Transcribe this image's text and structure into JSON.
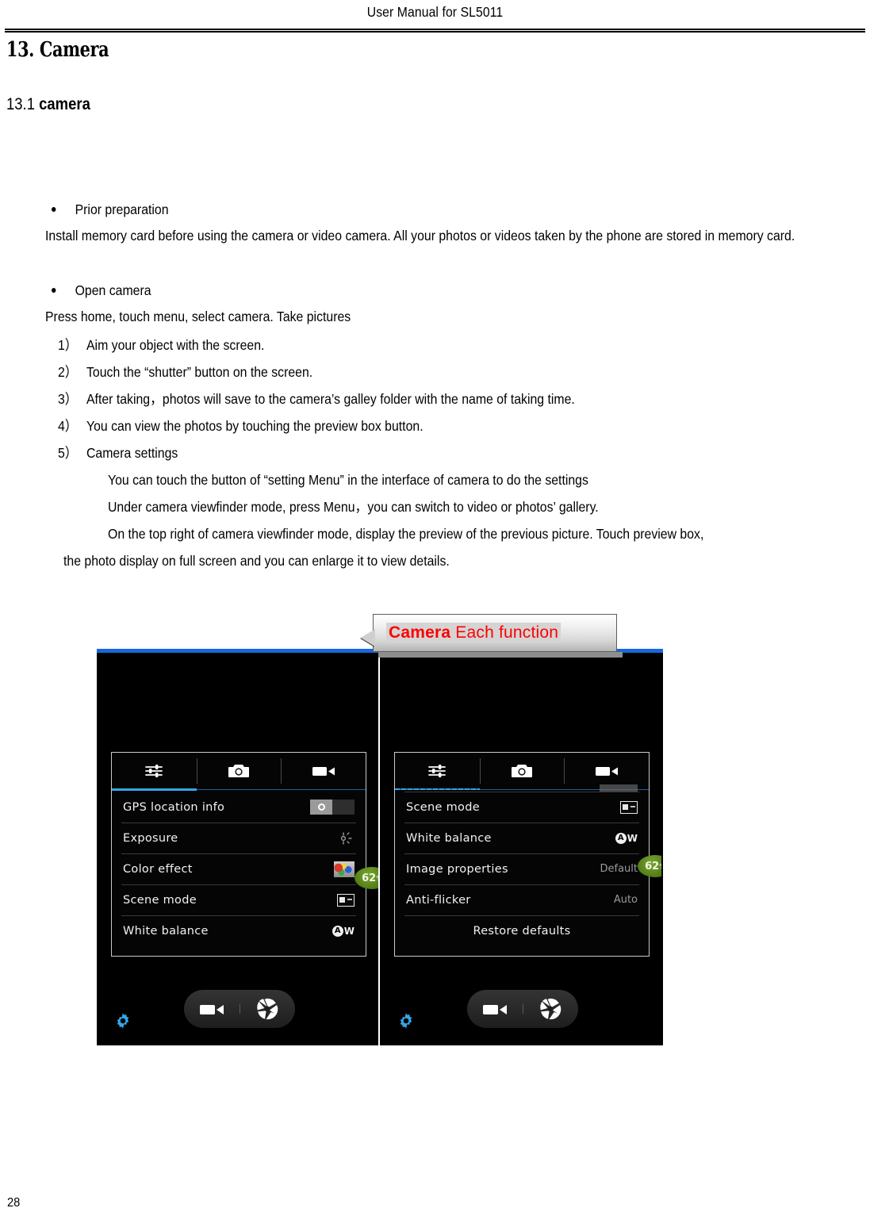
{
  "document": {
    "header_title": "User Manual for SL5011",
    "page_number": "28"
  },
  "headings": {
    "section_number": "13.",
    "section_title": "Camera",
    "sub_number": "13.1",
    "sub_title": "camera"
  },
  "bullets": [
    {
      "text": "Prior preparation"
    },
    {
      "text": "Open camera"
    }
  ],
  "paragraphs": {
    "prior_preparation_body": "Install memory card before using the camera or video camera. All your photos or videos taken by the phone are stored in memory card.",
    "open_camera_body": "Press home, touch menu, select camera. Take pictures"
  },
  "steps": [
    {
      "num": "1）",
      "text": "Aim your object with the screen."
    },
    {
      "num": "2）",
      "text": "Touch the “shutter” button on the screen."
    },
    {
      "num": "3）",
      "text": "After taking，photos will save to the camera’s galley folder with the name of taking time."
    },
    {
      "num": "4）",
      "text": "You can view the photos by touching the preview box button."
    },
    {
      "num": "5）",
      "text": "Camera settings"
    }
  ],
  "settings_notes": [
    "You can touch the button of “setting Menu” in the interface of camera to do the settings",
    "Under camera viewfinder mode, press Menu，you can switch to video or photos’ gallery.",
    "On the top right of camera viewfinder mode, display the preview of the previous picture. Touch preview box,",
    "the photo display on full screen and you can enlarge it to view details."
  ],
  "callout": {
    "bold_word": "Camera",
    "rest": " Each function",
    "color": "#ff0000"
  },
  "screenshots": {
    "accent_blue": "#33a7e8",
    "gear_color": "#33a7e8",
    "battery_badge": {
      "value": "62",
      "unit": "%"
    },
    "tabs": [
      {
        "name": "settings-tab",
        "icon": "sliders-icon",
        "active": true
      },
      {
        "name": "camera-tab",
        "icon": "camera-icon",
        "active": false
      },
      {
        "name": "video-tab",
        "icon": "video-camera-icon",
        "active": false
      }
    ],
    "left_panel": {
      "rows": [
        {
          "label": "GPS location info",
          "control": "toggle",
          "value": ""
        },
        {
          "label": "Exposure",
          "control": "exposure-icon",
          "value": ""
        },
        {
          "label": "Color effect",
          "control": "color-thumbnail",
          "value": ""
        },
        {
          "label": "Scene mode",
          "control": "scene-icon",
          "value": ""
        },
        {
          "label": "White balance",
          "control": "white-balance-icon",
          "value": ""
        }
      ]
    },
    "right_panel": {
      "rows": [
        {
          "label": "Scene mode",
          "control": "scene-icon",
          "value": ""
        },
        {
          "label": "White balance",
          "control": "white-balance-icon",
          "value": ""
        },
        {
          "label": "Image properties",
          "control": "text",
          "value": "Default"
        },
        {
          "label": "Anti-flicker",
          "control": "text",
          "value": "Auto"
        },
        {
          "label": "Restore defaults",
          "control": "none",
          "value": ""
        }
      ]
    },
    "bottom_controls": {
      "settings_gear": "gear-icon",
      "video_button": "video-camera-icon",
      "shutter_button": "aperture-shutter-icon"
    }
  }
}
